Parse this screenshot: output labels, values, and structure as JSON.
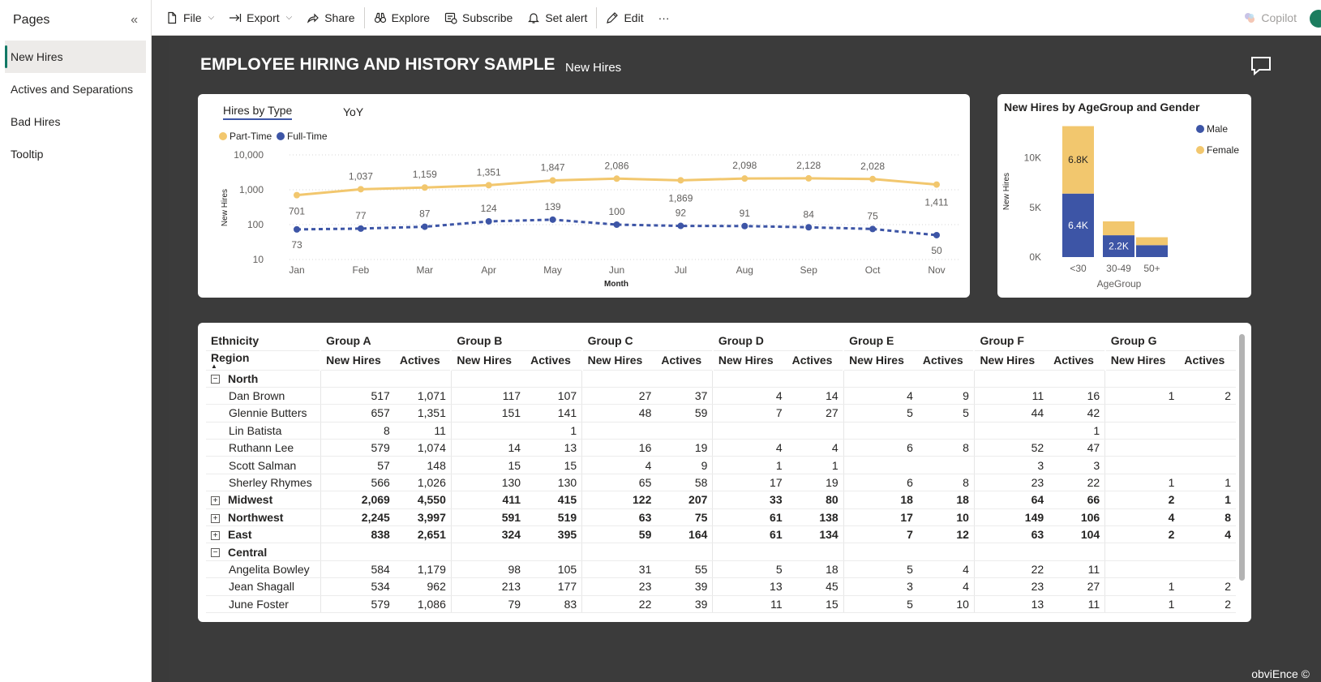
{
  "sidebar": {
    "title": "Pages",
    "collapse_glyph": "«",
    "items": [
      {
        "label": "New Hires",
        "active": true
      },
      {
        "label": "Actives and Separations"
      },
      {
        "label": "Bad Hires"
      },
      {
        "label": "Tooltip"
      }
    ]
  },
  "toolbar": {
    "file": "File",
    "export": "Export",
    "share": "Share",
    "explore": "Explore",
    "subscribe": "Subscribe",
    "set_alert": "Set alert",
    "edit": "Edit",
    "more": "···",
    "copilot": "Copilot"
  },
  "report": {
    "title": "EMPLOYEE HIRING AND HISTORY SAMPLE",
    "subtitle": "New Hires",
    "footer": "obviEnce ©"
  },
  "line_card": {
    "tabs": [
      "Hires by Type",
      "YoY"
    ]
  },
  "bar_card": {
    "title": "New Hires by AgeGroup and Gender"
  },
  "chart_data": [
    {
      "type": "line",
      "log_scale": true,
      "ylabel": "New Hires",
      "xlabel": "Month",
      "yticks": [
        "10",
        "100",
        "1,000",
        "10,000"
      ],
      "ylim": [
        10,
        10000
      ],
      "legend_position": "top-left",
      "categories": [
        "Jan",
        "Feb",
        "Mar",
        "Apr",
        "May",
        "Jun",
        "Jul",
        "Aug",
        "Sep",
        "Oct",
        "Nov"
      ],
      "series": [
        {
          "name": "Full-Time",
          "color": "#3d55a6",
          "dashed": true,
          "values": [
            73,
            77,
            87,
            124,
            139,
            100,
            92,
            91,
            84,
            75,
            50
          ],
          "labels": [
            "73",
            "77",
            "87",
            "124",
            "139",
            "100",
            "92",
            "91",
            "84",
            "75",
            "50"
          ]
        },
        {
          "name": "Part-Time",
          "color": "#f2c76e",
          "values": [
            701,
            1037,
            1159,
            1351,
            1847,
            2086,
            1869,
            2098,
            2128,
            2028,
            1411
          ],
          "labels": [
            "701",
            "1,037",
            "1,159",
            "1,351",
            "1,847",
            "2,086",
            "1,869",
            "2,098",
            "2,128",
            "2,028",
            "1,411"
          ]
        }
      ],
      "grid": true
    },
    {
      "type": "bar",
      "stacked": true,
      "xlabel": "AgeGroup",
      "ylabel": "New Hires",
      "categories": [
        "<30",
        "30-49",
        "50+"
      ],
      "yticks": [
        "0K",
        "5K",
        "10K"
      ],
      "ylim": [
        0,
        13000
      ],
      "legend_position": "top-right",
      "series": [
        {
          "name": "Male",
          "color": "#3d55a6",
          "values": [
            6400,
            2200,
            1200
          ],
          "labels": [
            "6.4K",
            "2.2K",
            ""
          ]
        },
        {
          "name": "Female",
          "color": "#f2c76e",
          "values": [
            6800,
            1400,
            800
          ],
          "labels": [
            "6.8K",
            "",
            ""
          ]
        }
      ]
    }
  ],
  "matrix": {
    "corner_top": "Ethnicity",
    "corner_bottom": "Region",
    "groups": [
      "Group A",
      "Group B",
      "Group C",
      "Group D",
      "Group E",
      "Group F",
      "Group G"
    ],
    "sub_headers": [
      "New Hires",
      "Actives"
    ],
    "rows": [
      {
        "type": "group",
        "expanded": true,
        "label": "North",
        "cells": [
          "",
          "",
          "",
          "",
          "",
          "",
          "",
          "",
          "",
          "",
          "",
          "",
          "",
          ""
        ]
      },
      {
        "type": "detail",
        "label": "Dan Brown",
        "cells": [
          "517",
          "1,071",
          "117",
          "107",
          "27",
          "37",
          "4",
          "14",
          "4",
          "9",
          "11",
          "16",
          "1",
          "2"
        ]
      },
      {
        "type": "detail",
        "label": "Glennie Butters",
        "cells": [
          "657",
          "1,351",
          "151",
          "141",
          "48",
          "59",
          "7",
          "27",
          "5",
          "5",
          "44",
          "42",
          "",
          ""
        ]
      },
      {
        "type": "detail",
        "label": "Lin Batista",
        "cells": [
          "8",
          "11",
          "",
          "1",
          "",
          "",
          "",
          "",
          "",
          "",
          "",
          "1",
          "",
          ""
        ]
      },
      {
        "type": "detail",
        "label": "Ruthann Lee",
        "cells": [
          "579",
          "1,074",
          "14",
          "13",
          "16",
          "19",
          "4",
          "4",
          "6",
          "8",
          "52",
          "47",
          "",
          ""
        ]
      },
      {
        "type": "detail",
        "label": "Scott Salman",
        "cells": [
          "57",
          "148",
          "15",
          "15",
          "4",
          "9",
          "1",
          "1",
          "",
          "",
          "3",
          "3",
          "",
          ""
        ]
      },
      {
        "type": "detail",
        "label": "Sherley Rhymes",
        "cells": [
          "566",
          "1,026",
          "130",
          "130",
          "65",
          "58",
          "17",
          "19",
          "6",
          "8",
          "23",
          "22",
          "1",
          "1"
        ]
      },
      {
        "type": "group",
        "expanded": false,
        "label": "Midwest",
        "cells": [
          "2,069",
          "4,550",
          "411",
          "415",
          "122",
          "207",
          "33",
          "80",
          "18",
          "18",
          "64",
          "66",
          "2",
          "1"
        ]
      },
      {
        "type": "group",
        "expanded": false,
        "label": "Northwest",
        "cells": [
          "2,245",
          "3,997",
          "591",
          "519",
          "63",
          "75",
          "61",
          "138",
          "17",
          "10",
          "149",
          "106",
          "4",
          "8"
        ]
      },
      {
        "type": "group",
        "expanded": false,
        "label": "East",
        "cells": [
          "838",
          "2,651",
          "324",
          "395",
          "59",
          "164",
          "61",
          "134",
          "7",
          "12",
          "63",
          "104",
          "2",
          "4"
        ]
      },
      {
        "type": "group",
        "expanded": true,
        "label": "Central",
        "cells": [
          "",
          "",
          "",
          "",
          "",
          "",
          "",
          "",
          "",
          "",
          "",
          "",
          "",
          ""
        ]
      },
      {
        "type": "detail",
        "label": "Angelita Bowley",
        "cells": [
          "584",
          "1,179",
          "98",
          "105",
          "31",
          "55",
          "5",
          "18",
          "5",
          "4",
          "22",
          "11",
          "",
          ""
        ]
      },
      {
        "type": "detail",
        "label": "Jean Shagall",
        "cells": [
          "534",
          "962",
          "213",
          "177",
          "23",
          "39",
          "13",
          "45",
          "3",
          "4",
          "23",
          "27",
          "1",
          "2"
        ]
      },
      {
        "type": "detail",
        "label": "June Foster",
        "cells": [
          "579",
          "1,086",
          "79",
          "83",
          "22",
          "39",
          "11",
          "15",
          "5",
          "10",
          "13",
          "11",
          "1",
          "2"
        ]
      }
    ]
  }
}
